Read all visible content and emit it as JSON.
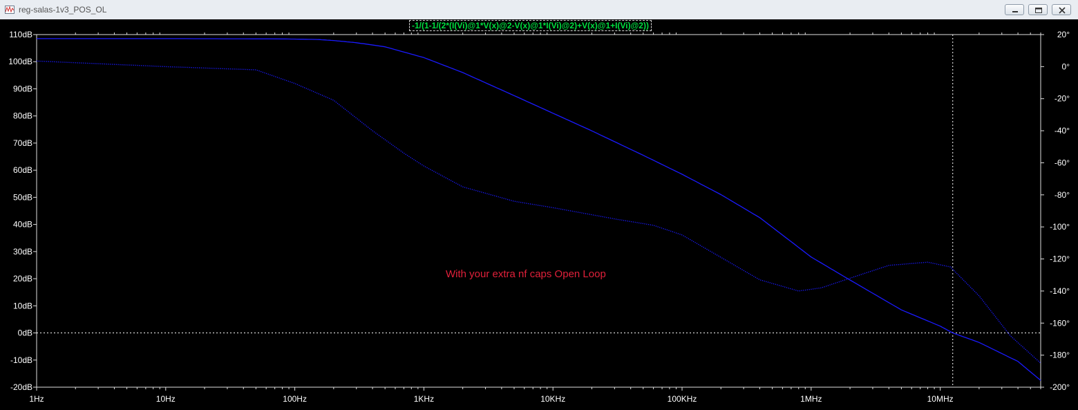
{
  "window": {
    "title": "reg-salas-1v3_POS_OL",
    "icon": "waveform-viewer-icon",
    "buttons": [
      "minimize-icon",
      "restore-icon",
      "close-icon"
    ]
  },
  "trace_expression": "-1/(1-1/(2*(I(Vi)@1*V(x)@2-V(x)@1*I(Vi)@2)+V(x)@1+I(Vi)@2))",
  "annotation": "With your extra nf caps Open Loop",
  "colors": {
    "background": "#000000",
    "trace": "#1a1aff",
    "expression": "#00e040",
    "annotation": "#e0203a",
    "axis": "#e0e0e0"
  },
  "chart_data": {
    "type": "line",
    "title": "",
    "xscale": "log",
    "xlim": [
      1,
      60000000
    ],
    "x_ticks": [
      {
        "v": 1,
        "label": "1Hz"
      },
      {
        "v": 10,
        "label": "10Hz"
      },
      {
        "v": 100,
        "label": "100Hz"
      },
      {
        "v": 1000,
        "label": "1KHz"
      },
      {
        "v": 10000,
        "label": "10KHz"
      },
      {
        "v": 100000,
        "label": "100KHz"
      },
      {
        "v": 1000000,
        "label": "1MHz"
      },
      {
        "v": 10000000,
        "label": "10MHz"
      }
    ],
    "ylim": [
      -20,
      110
    ],
    "y_ticks": [
      {
        "v": 110,
        "label": "110dB"
      },
      {
        "v": 100,
        "label": "100dB"
      },
      {
        "v": 90,
        "label": "90dB"
      },
      {
        "v": 80,
        "label": "80dB"
      },
      {
        "v": 70,
        "label": "70dB"
      },
      {
        "v": 60,
        "label": "60dB"
      },
      {
        "v": 50,
        "label": "50dB"
      },
      {
        "v": 40,
        "label": "40dB"
      },
      {
        "v": 30,
        "label": "30dB"
      },
      {
        "v": 20,
        "label": "20dB"
      },
      {
        "v": 10,
        "label": "10dB"
      },
      {
        "v": 0,
        "label": "0dB"
      },
      {
        "v": -10,
        "label": "-10dB"
      },
      {
        "v": -20,
        "label": "-20dB"
      }
    ],
    "y2lim": [
      -200,
      20
    ],
    "y2_ticks": [
      {
        "v": 20,
        "label": "20°"
      },
      {
        "v": 0,
        "label": "0°"
      },
      {
        "v": -20,
        "label": "-20°"
      },
      {
        "v": -40,
        "label": "-40°"
      },
      {
        "v": -60,
        "label": "-60°"
      },
      {
        "v": -80,
        "label": "-80°"
      },
      {
        "v": -100,
        "label": "-100°"
      },
      {
        "v": -120,
        "label": "-120°"
      },
      {
        "v": -140,
        "label": "-140°"
      },
      {
        "v": -160,
        "label": "-160°"
      },
      {
        "v": -180,
        "label": "-180°"
      },
      {
        "v": -200,
        "label": "-200°"
      }
    ],
    "grid": false,
    "series": [
      {
        "kind": "magnitude_dB",
        "axis": "left",
        "style": "solid",
        "x": [
          1,
          10,
          80,
          150,
          200,
          300,
          500,
          1000,
          2000,
          5000,
          10000,
          20000,
          50000,
          100000,
          200000,
          400000,
          1000000,
          2000000,
          5000000,
          10000000,
          12500000,
          20000000,
          40000000,
          60000000
        ],
        "y": [
          108.5,
          108.5,
          108.4,
          108.2,
          107.8,
          107,
          105.5,
          101.5,
          96,
          87.5,
          81,
          74.5,
          65.5,
          58.5,
          51,
          42.5,
          28,
          19.5,
          8.5,
          2.5,
          0,
          -3.5,
          -10.5,
          -17.5
        ]
      },
      {
        "kind": "phase_deg",
        "axis": "right",
        "style": "dotted",
        "x": [
          1,
          10,
          50,
          100,
          200,
          400,
          700,
          1000,
          2000,
          5000,
          10000,
          30000,
          60000,
          100000,
          200000,
          400000,
          800000,
          1200000,
          2000000,
          4000000,
          8000000,
          12000000,
          20000000,
          35000000,
          60000000
        ],
        "y": [
          3.5,
          0,
          -2,
          -10.5,
          -21,
          -40,
          -54,
          -62,
          -75,
          -84,
          -88,
          -95,
          -99,
          -105,
          -119,
          -133,
          -140,
          -138,
          -132,
          -124,
          -122,
          -125,
          -143,
          -168,
          -185
        ]
      }
    ],
    "cursors": {
      "x": 12500000,
      "y": 0
    }
  }
}
